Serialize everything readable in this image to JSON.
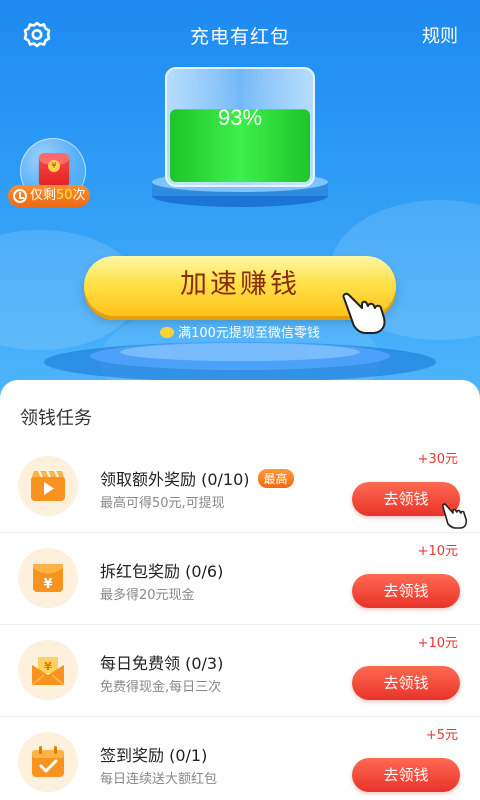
{
  "header": {
    "title": "充电有红包",
    "rules_label": "规则",
    "settings_icon": "gear-icon"
  },
  "battery": {
    "level_text": "93%",
    "level_fraction": 0.93,
    "fill_color": "#2edc3a"
  },
  "bonus_bubble": {
    "icon": "red-envelope-icon",
    "remain_prefix": "仅剩",
    "remain_count": "50",
    "remain_suffix": "次"
  },
  "main_action": {
    "label": "加速赚钱",
    "tip": "满100元提现至微信零钱"
  },
  "tasks": {
    "title": "领钱任务",
    "items": [
      {
        "icon": "video-play-icon",
        "name": "领取额外奖励 (0/10)",
        "badge": "最高",
        "desc": "最高可得50元,可提现",
        "reward": "+30元",
        "button": "去领钱"
      },
      {
        "icon": "yuan-envelope-icon",
        "name": "拆红包奖励 (0/6)",
        "badge": "",
        "desc": "最多得20元现金",
        "reward": "+10元",
        "button": "去领钱"
      },
      {
        "icon": "yuan-wallet-icon",
        "name": "每日免费领 (0/3)",
        "badge": "",
        "desc": "免费得现金,每日三次",
        "reward": "+10元",
        "button": "去领钱"
      },
      {
        "icon": "calendar-check-icon",
        "name": "签到奖励 (0/1)",
        "badge": "",
        "desc": "每日连续送大额红包",
        "reward": "+5元",
        "button": "去领钱"
      }
    ]
  },
  "colors": {
    "hero_blue": "#1e8af2",
    "button_yellow": "#ffe14a",
    "action_red": "#e8332a",
    "icon_orange": "#f7931e"
  }
}
